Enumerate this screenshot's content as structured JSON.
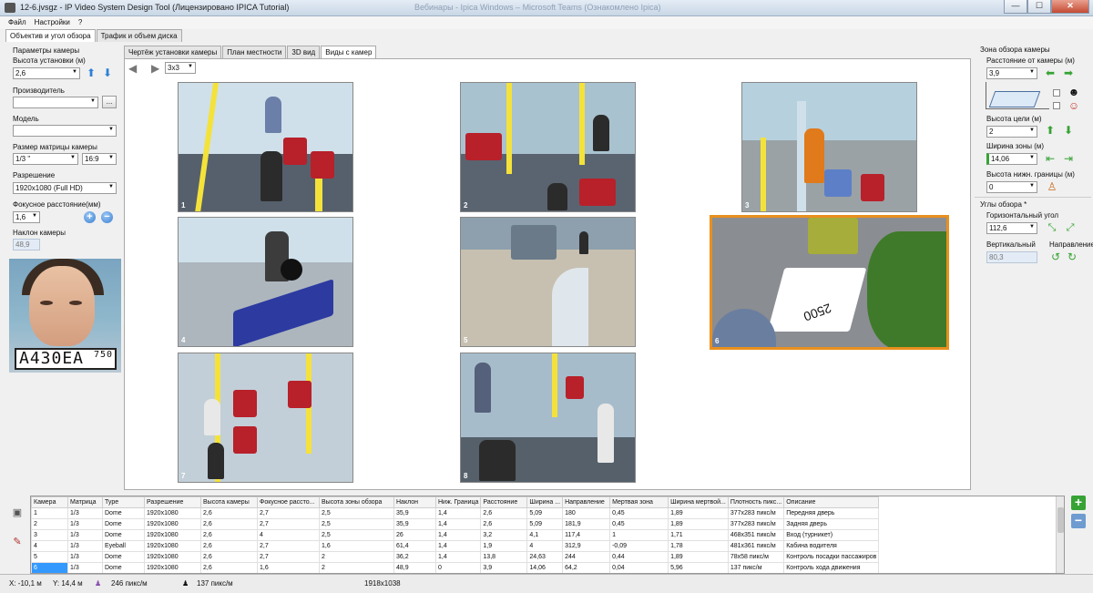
{
  "window": {
    "title": "12-6.jvsgz - IP Video System Design Tool (Лицензировано  IPICA Tutorial)",
    "blurred_title": "Вебинары - Ipica Windows – Microsoft Teams (Ознакомлено Ipica)",
    "minimize": "—",
    "maximize": "☐",
    "close": "✕"
  },
  "menu": [
    "Файл",
    "Настройки",
    "?"
  ],
  "top_tabs": [
    "Объектив и угол обзора",
    "Трафик и объем диска"
  ],
  "left": {
    "camera_params_title": "Параметры камеры",
    "height_label": "Высота установки (м)",
    "height_value": "2,6",
    "manufacturer_label": "Производитель",
    "manufacturer_value": "",
    "browse_label": "...",
    "model_label": "Модель",
    "model_value": "",
    "sensor_label": "Размер матрицы камеры",
    "sensor_value": "1/3 \"",
    "aspect_value": "16:9",
    "resolution_label": "Разрешение",
    "resolution_value": "1920x1080 (Full HD)",
    "focal_label": "Фокусное расстояние(мм)",
    "focal_value": "1,6",
    "tilt_label": "Наклон камеры",
    "tilt_value": "48,9",
    "plate_text": "А430ЕА",
    "plate_region": "750"
  },
  "center": {
    "tabs": [
      "Чертёж установки камеры",
      "План местности",
      "3D вид",
      "Виды с камер"
    ],
    "grid_select": "3x3",
    "prev_icon": "◀",
    "next_icon": "▶",
    "views": [
      "1",
      "2",
      "3",
      "4",
      "5",
      "6",
      "7",
      "8"
    ],
    "marking_text": "2500"
  },
  "right": {
    "zone_title": "Зона обзора камеры",
    "distance_label": "Расстояние от камеры (м)",
    "distance_value": "3,9",
    "target_height_label": "Высота цели (м)",
    "target_height_value": "2",
    "zone_width_label": "Ширина зоны (м)",
    "zone_width_value": "14,06",
    "lower_bound_label": "Высота нижн. границы (м)",
    "lower_bound_value": "0",
    "angles_title": "Углы обзора *",
    "h_angle_label": "Горизонтальный угол",
    "h_angle_value": "112,6",
    "v_angle_label": "Вертикальный",
    "v_angle_value": "80,3",
    "direction_label": "Направление"
  },
  "table": {
    "columns": [
      "Камера",
      "Матрица",
      "Type",
      "Разрешение",
      "Высота камеры",
      "Фокусное рассто...",
      "Высота зоны обзора",
      "Наклон",
      "Ниж. Граница",
      "Расстояние",
      "Ширина ...",
      "Направление",
      "Мертвая зона",
      "Ширина мертвой...",
      "Плотность пикс...",
      "Описание"
    ],
    "rows": [
      [
        "1",
        "1/3",
        "Dome",
        "1920x1080",
        "2,6",
        "2,7",
        "2,5",
        "35,9",
        "1,4",
        "2,6",
        "5,09",
        "180",
        "0,45",
        "1,89",
        "377x283 пикс/м",
        "Передняя дверь"
      ],
      [
        "2",
        "1/3",
        "Dome",
        "1920x1080",
        "2,6",
        "2,7",
        "2,5",
        "35,9",
        "1,4",
        "2,6",
        "5,09",
        "181,9",
        "0,45",
        "1,89",
        "377x283 пикс/м",
        "Задняя дверь"
      ],
      [
        "3",
        "1/3",
        "Dome",
        "1920x1080",
        "2,6",
        "4",
        "2,5",
        "26",
        "1,4",
        "3,2",
        "4,1",
        "117,4",
        "1",
        "1,71",
        "468x351 пикс/м",
        "Вход (турникет)"
      ],
      [
        "4",
        "1/3",
        "Eyeball",
        "1920x1080",
        "2,6",
        "2,7",
        "1,6",
        "61,4",
        "1,4",
        "1,9",
        "4",
        "312,9",
        "-0,09",
        "1,78",
        "481x361 пикс/м",
        "Кабина водителя"
      ],
      [
        "5",
        "1/3",
        "Dome",
        "1920x1080",
        "2,6",
        "2,7",
        "2",
        "36,2",
        "1,4",
        "13,8",
        "24,63",
        "244",
        "0,44",
        "1,89",
        "78x58 пикс/м",
        "Контроль посадки пассажиров"
      ],
      [
        "6",
        "1/3",
        "Dome",
        "1920x1080",
        "2,6",
        "1,6",
        "2",
        "48,9",
        "0",
        "3,9",
        "14,06",
        "64,2",
        "0,04",
        "5,96",
        "137 пикс/м",
        "Контроль хода движения"
      ]
    ]
  },
  "status": {
    "x": "X: -10,1 м",
    "y": "Y: 14,4 м",
    "density1": "246 пикс/м",
    "density2": "137 пикс/м",
    "resolution": "1918x1038"
  },
  "colors": {
    "accent": "#e8901e",
    "selection": "#3399ff",
    "pole": "#f4e23a",
    "seat": "#b8202a"
  }
}
